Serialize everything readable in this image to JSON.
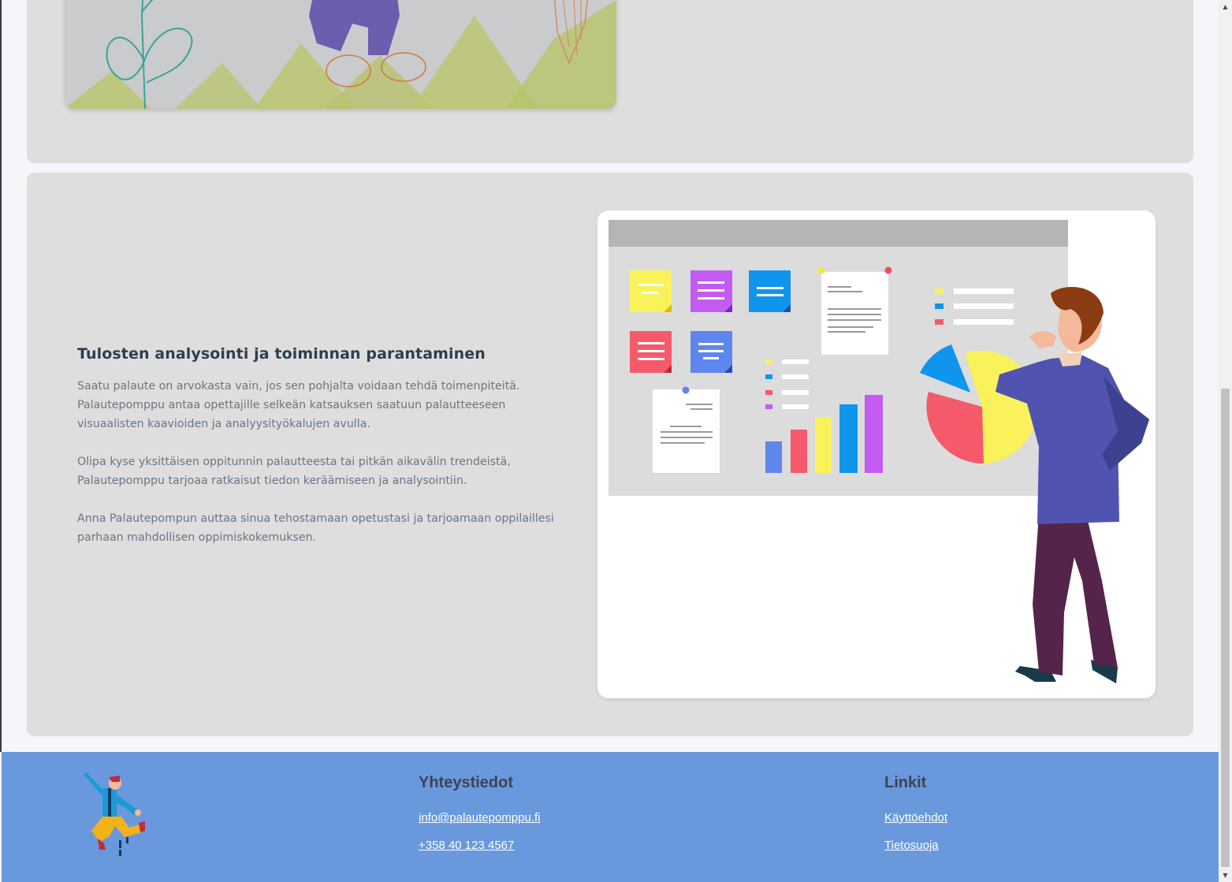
{
  "section": {
    "heading": "Tulosten analysointi ja toiminnan parantaminen",
    "paragraphs": [
      "Saatu palaute on arvokasta vain, jos sen pohjalta voidaan tehdä toimenpiteitä. Palautepomppu antaa opettajille selkeän katsauksen saatuun palautteeseen visuaalisten kaavioiden ja analyysityökalujen avulla.",
      "Olipa kyse yksittäisen oppitunnin palautteesta tai pitkän aikavälin trendeistä, Palautepomppu tarjoaa ratkaisut tiedon keräämiseen ja analysointiin.",
      "Anna Palautepompun auttaa sinua tehostamaan opetustasi ja tarjoamaan oppilaillesi parhaan mahdollisen oppimiskokemuksen."
    ]
  },
  "footer": {
    "contact": {
      "heading": "Yhteystiedot",
      "email": "info@palautepomppu.fi",
      "phone": "+358 40 123 4567"
    },
    "links": {
      "heading": "Linkit",
      "terms": "Käyttöehdot",
      "privacy": "Tietosuoja"
    }
  },
  "colors": {
    "card_bg": "#dedede",
    "footer_bg": "#6a98dd",
    "heading": "#2c3e50",
    "body_text": "#6c7580"
  },
  "icons": {
    "illustration": "analytics-board-illustration",
    "logo": "jumping-figure-logo"
  }
}
